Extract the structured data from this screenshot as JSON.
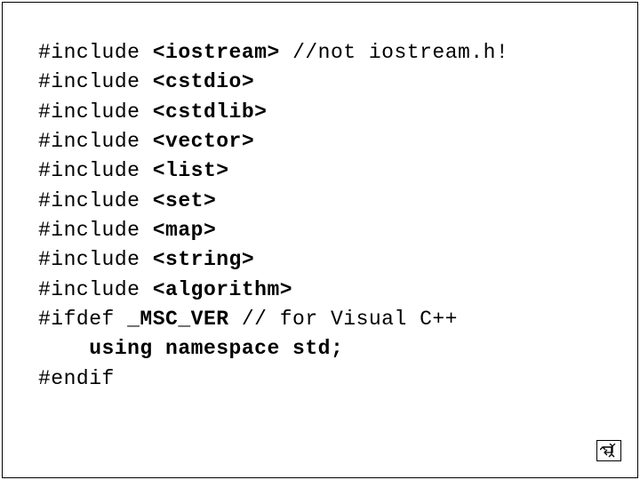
{
  "code": {
    "lines": [
      {
        "plain": "#include ",
        "bold": "<iostream>",
        "tail": " //not iostream.h!"
      },
      {
        "plain": "#include ",
        "bold": "<cstdio>",
        "tail": ""
      },
      {
        "plain": "#include ",
        "bold": "<cstdlib>",
        "tail": ""
      },
      {
        "plain": "#include ",
        "bold": "<vector>",
        "tail": ""
      },
      {
        "plain": "#include ",
        "bold": "<list>",
        "tail": ""
      },
      {
        "plain": "#include ",
        "bold": "<set>",
        "tail": ""
      },
      {
        "plain": "#include ",
        "bold": "<map>",
        "tail": ""
      },
      {
        "plain": "#include ",
        "bold": "<string>",
        "tail": ""
      },
      {
        "plain": "#include ",
        "bold": "<algorithm>",
        "tail": ""
      }
    ],
    "ifdef_plain": "#ifdef ",
    "ifdef_bold": "_MSC_VER",
    "ifdef_tail": " // for Visual C++",
    "using_indent": "    ",
    "using_bold": "using namespace std;",
    "endif": "#endif"
  },
  "icons": {
    "return": "return-icon"
  }
}
